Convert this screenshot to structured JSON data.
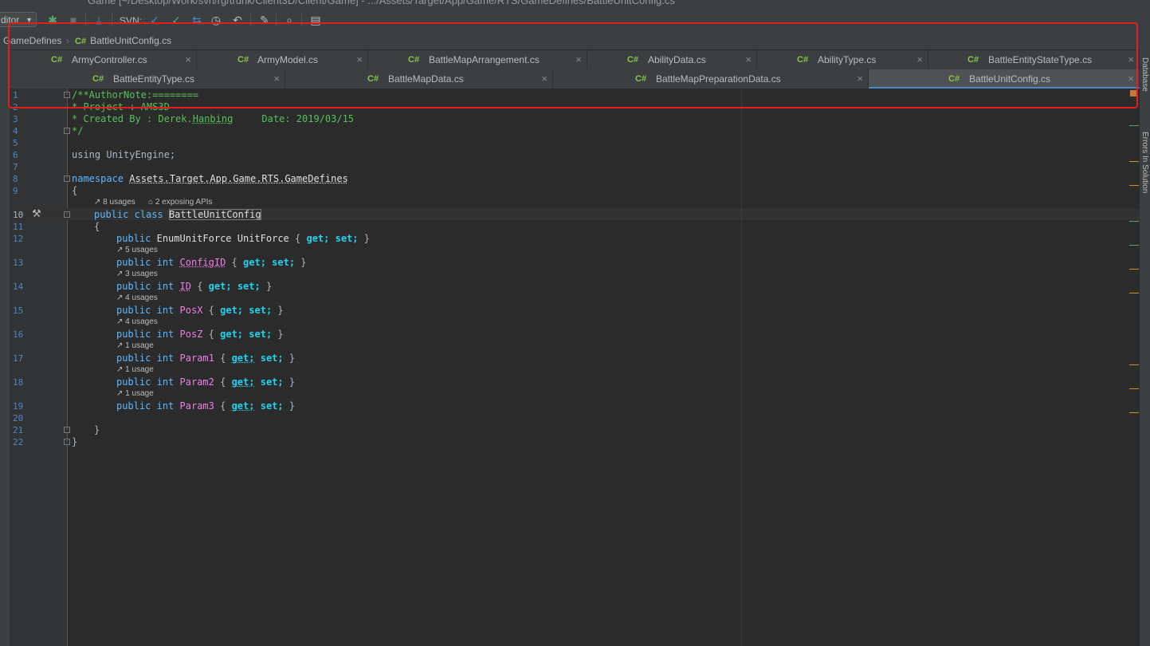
{
  "window": {
    "title": "Game [~/Desktop/Work/svn/rg/trunk/Client3D/Client/Game] - .../Assets/Target/App/Game/RTS/GameDefines/BattleUnitConfig.cs"
  },
  "toolbar": {
    "config_combo": "ditor",
    "svn_label": "SVN:",
    "icons": [
      "bug-icon",
      "stop-icon",
      "download-icon",
      "svn-update-icon",
      "svn-commit-icon",
      "svn-compare-icon",
      "history-icon",
      "revert-icon",
      "wrench-icon",
      "search-icon",
      "sdk-manager-icon"
    ]
  },
  "breadcrumb": {
    "folder": "GameDefines",
    "file": "BattleUnitConfig.cs",
    "file_badge": "C#"
  },
  "tabs": {
    "row1": [
      {
        "label": "ArmyController.cs",
        "badge": "C#"
      },
      {
        "label": "ArmyModel.cs",
        "badge": "C#"
      },
      {
        "label": "BattleMapArrangement.cs",
        "badge": "C#"
      },
      {
        "label": "AbilityData.cs",
        "badge": "C#"
      },
      {
        "label": "AbilityType.cs",
        "badge": "C#"
      },
      {
        "label": "BattleEntityStateType.cs",
        "badge": "C#"
      }
    ],
    "row2": [
      {
        "label": "BattleEntityType.cs",
        "badge": "C#"
      },
      {
        "label": "BattleMapData.cs",
        "badge": "C#"
      },
      {
        "label": "BattleMapPreparationData.cs",
        "badge": "C#"
      },
      {
        "label": "BattleUnitConfig.cs",
        "badge": "C#",
        "active": true
      }
    ],
    "close_glyph": "×"
  },
  "side_panels": {
    "database": "Database",
    "errors": "Errors In Solution"
  },
  "code": {
    "line_numbers": [
      "1",
      "2",
      "3",
      "4",
      "5",
      "6",
      "7",
      "8",
      "9",
      "10",
      "11",
      "12",
      "13",
      "14",
      "15",
      "16",
      "17",
      "18",
      "19",
      "20",
      "21",
      "22"
    ],
    "header": {
      "l1": "/**AuthorNote:========",
      "l2": "* Project : AMS3D",
      "l3_a": "* Created By : Derek.",
      "l3_b": "Hanbing",
      "l3_c": "     Date: 2019/03/15",
      "l4": "*/"
    },
    "using": {
      "kw": "using",
      "name": "UnityEngine;"
    },
    "namespace": {
      "kw": "namespace",
      "name": "Assets.Target.App.Game.RTS.GameDefines"
    },
    "open_brace": "{",
    "close_brace": "}",
    "class_hint": {
      "usages": "8 usages",
      "apis": "2 exposing APIs"
    },
    "class_decl": {
      "public": "public",
      "class": "class",
      "name": "BattleUnitConfig"
    },
    "members": [
      {
        "type": "EnumUnitForce",
        "name": "UnitForce",
        "hint": ""
      },
      {
        "type": "int",
        "name": "ConfigID",
        "hint": "5 usages"
      },
      {
        "type": "int",
        "name": "ID",
        "hint": "3 usages"
      },
      {
        "type": "int",
        "name": "PosX",
        "hint": "4 usages"
      },
      {
        "type": "int",
        "name": "PosZ",
        "hint": "4 usages"
      },
      {
        "type": "int",
        "name": "Param1",
        "hint": "1 usage"
      },
      {
        "type": "int",
        "name": "Param2",
        "hint": "1 usage"
      },
      {
        "type": "int",
        "name": "Param3",
        "hint": "1 usage"
      }
    ],
    "accessor": {
      "public": "public",
      "open": "{",
      "get": "get;",
      "set": "set;",
      "close": "}"
    }
  },
  "colors": {
    "highlight_box": "#e0201c",
    "cs_badge": "#8bc34a",
    "line_number": "#4a88c7",
    "property": "#ee7ee8",
    "accessor": "#22d3ee",
    "comment": "#56c05a"
  }
}
